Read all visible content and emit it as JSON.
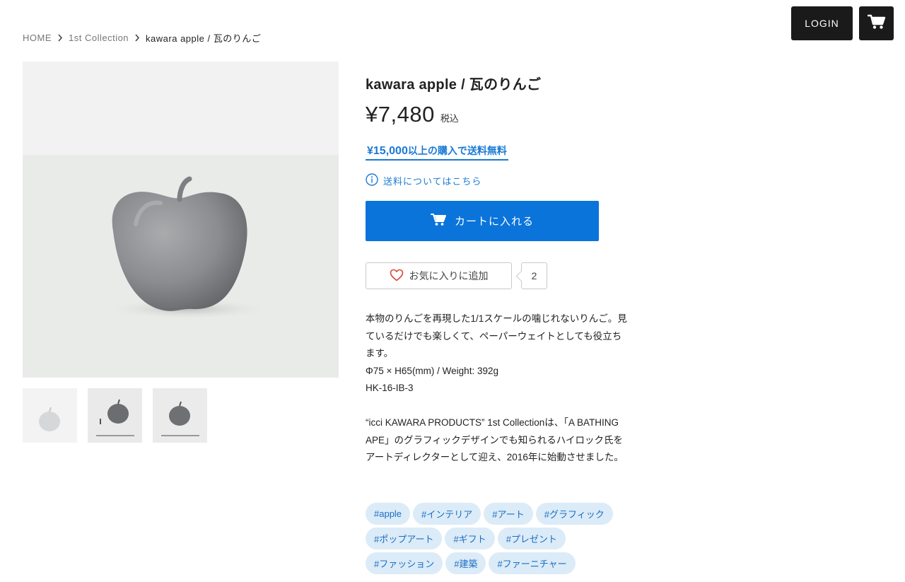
{
  "header": {
    "login_label": "LOGIN",
    "cart_icon": "cart-icon"
  },
  "breadcrumb": [
    {
      "label": "HOME"
    },
    {
      "label": "1st Collection"
    },
    {
      "label": "kawara apple / 瓦のりんご"
    }
  ],
  "product": {
    "title": "kawara apple / 瓦のりんご",
    "price": "¥7,480",
    "tax_label": "税込",
    "free_shipping_amount": "¥15,000",
    "free_shipping_text": "以上の購入で送料無料",
    "shipping_info_label": "送料についてはこちら",
    "add_to_cart_label": "カートに入れる",
    "favorite_label": "お気に入りに追加",
    "favorite_count": "2",
    "description": [
      "本物のりんごを再現した1/1スケールの噛じれないりんご。見ているだけでも楽しくて、ペーパーウェイトとしても役立ちます。",
      "Φ75 × H65(mm) / Weight: 392g",
      "HK-16-IB-3",
      "",
      "“icci KAWARA PRODUCTS” 1st Collectionは、「A BATHING APE」のグラフィックデザインでも知られるハイロック氏をアートディレクターとして迎え、2016年に始動させました。"
    ],
    "tags": [
      "#apple",
      "#インテリア",
      "#アート",
      "#グラフィック",
      "#ポップアート",
      "#ギフト",
      "#プレゼント",
      "#ファッション",
      "#建築",
      "#ファーニチャー"
    ]
  },
  "colors": {
    "accent": "#0a74da",
    "link": "#1a7ad6",
    "tag_bg": "#dcebf8",
    "dark": "#1a1a1a"
  }
}
